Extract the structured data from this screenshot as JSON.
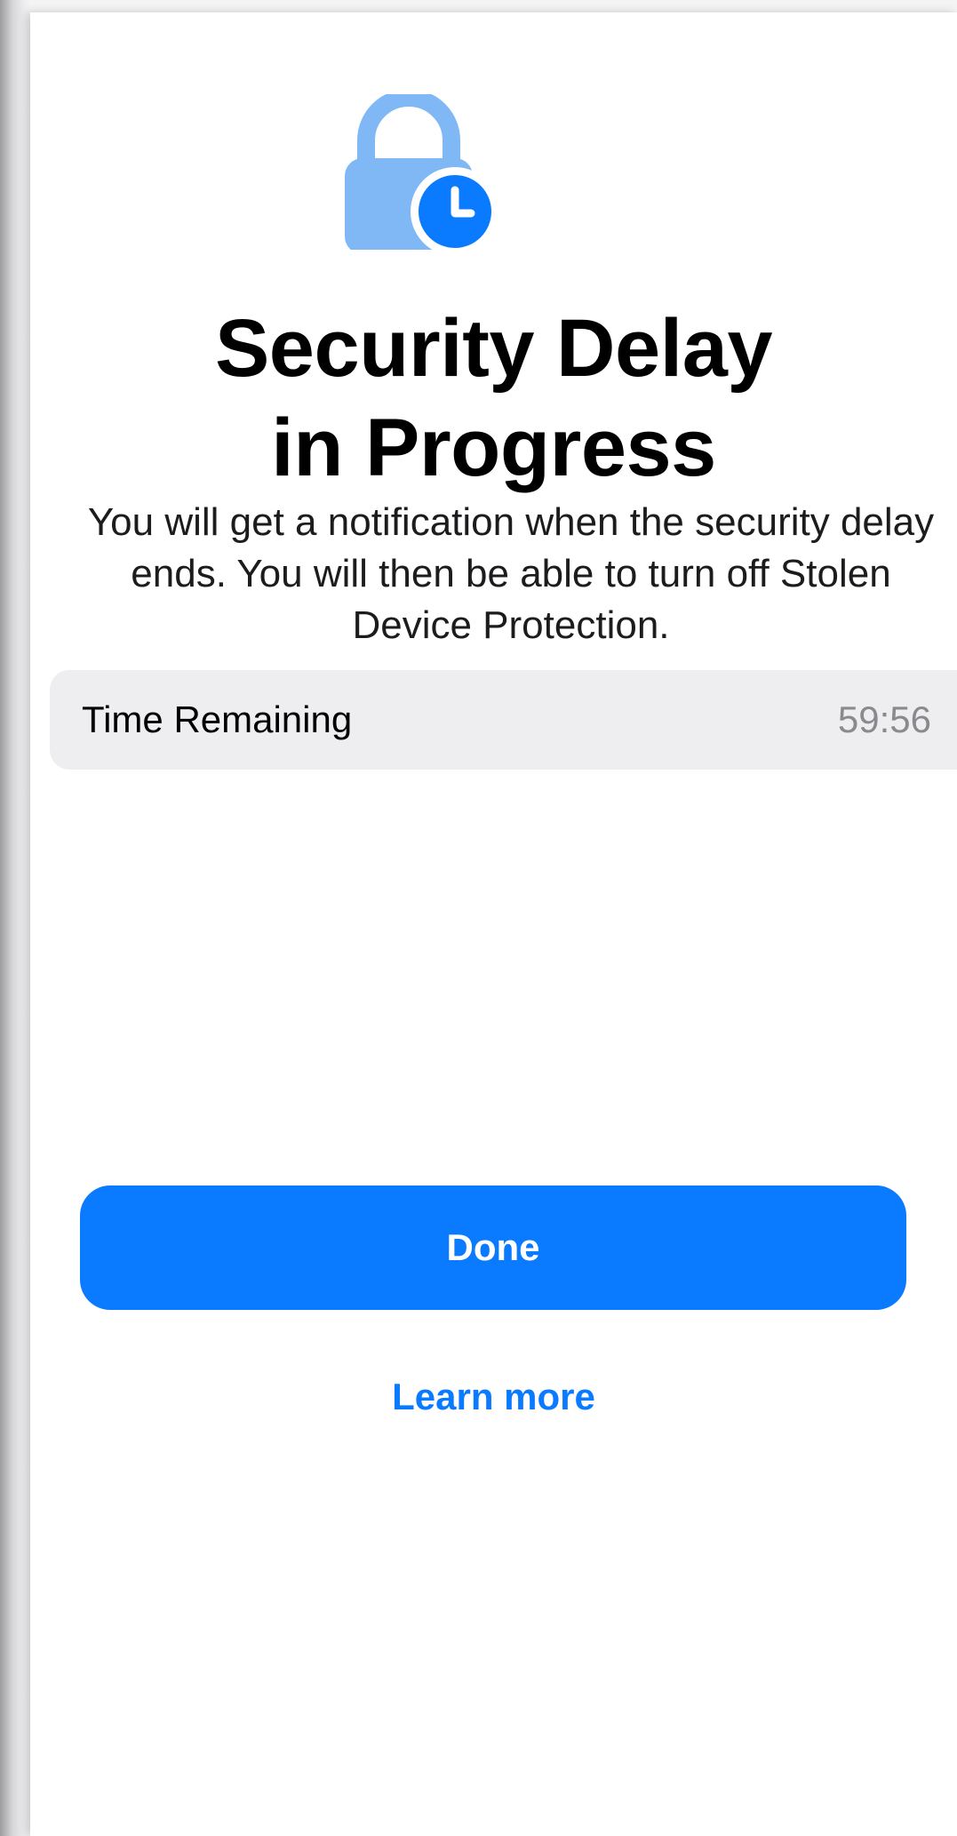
{
  "header": {
    "icon": "lock-clock-icon",
    "title_line1": "Security Delay",
    "title_line2": "in Progress"
  },
  "description": "You will get a notification when the security delay ends. You will then be able to turn off Stolen Device Protection.",
  "time_row": {
    "label": "Time Remaining",
    "value": "59:56"
  },
  "actions": {
    "done_label": "Done",
    "learn_more_label": "Learn more"
  },
  "colors": {
    "accent": "#0a7aff",
    "lock_body": "#7fb8f4",
    "row_background": "#eeeef0",
    "secondary_text": "#8a8a8e"
  }
}
